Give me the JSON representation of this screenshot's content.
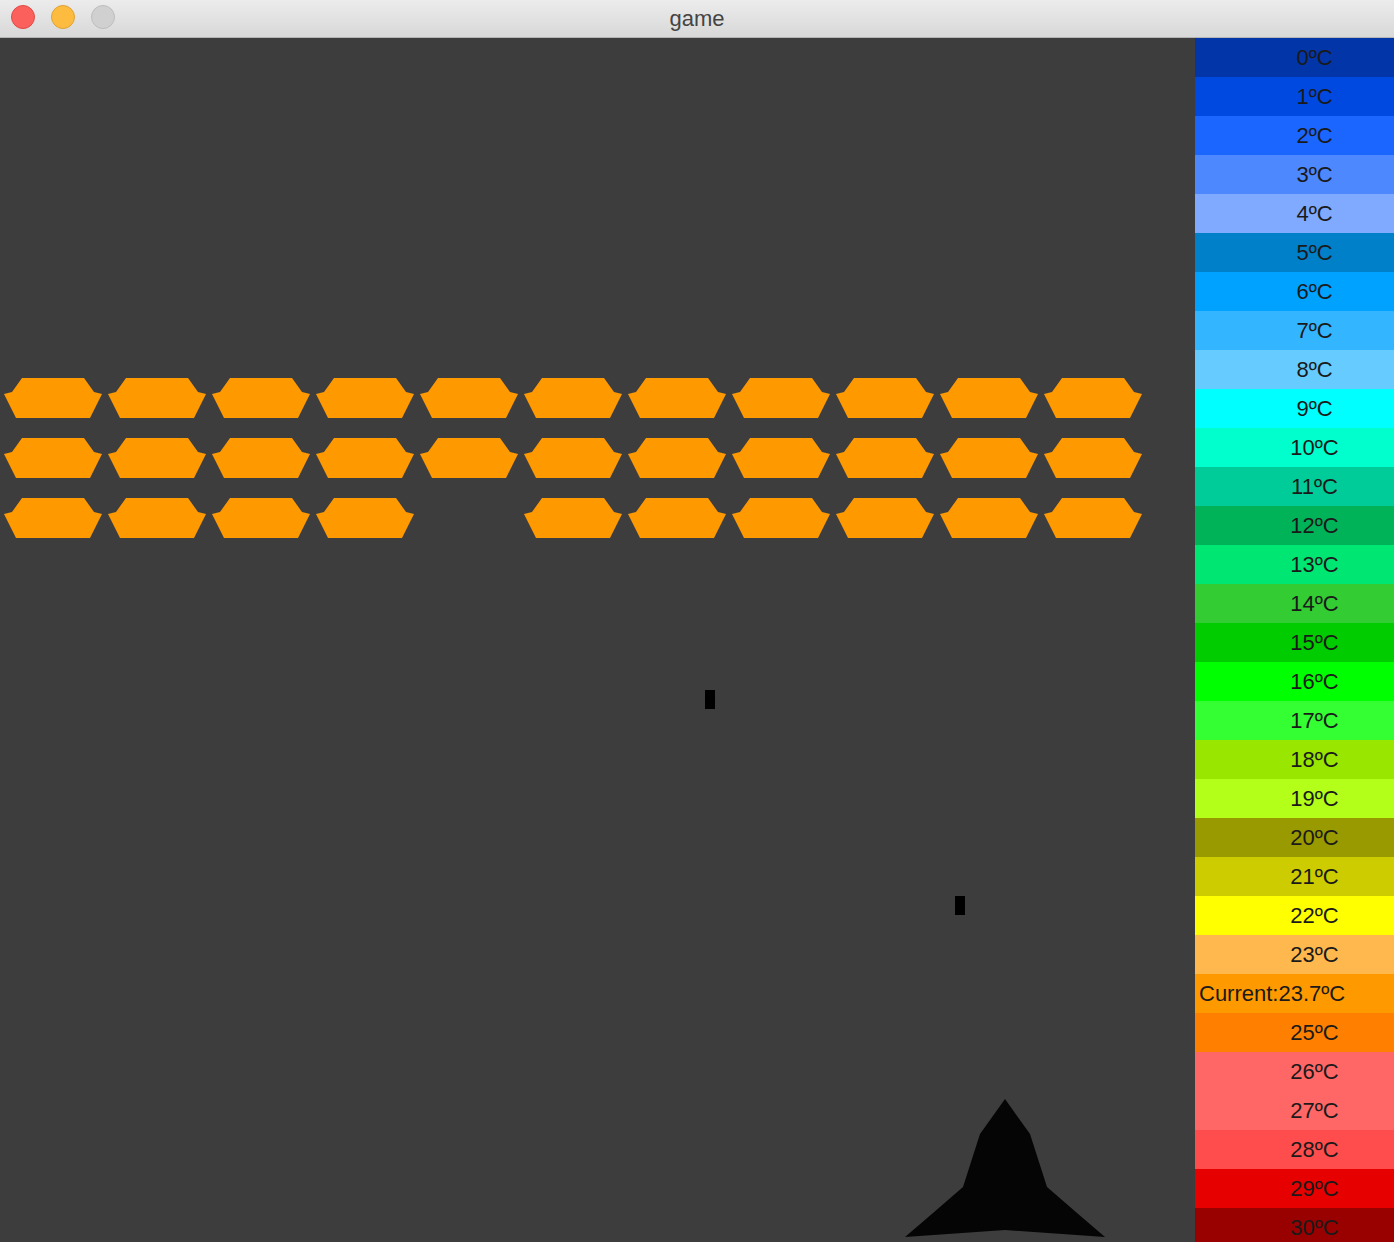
{
  "window": {
    "title": "game"
  },
  "enemies": [
    [
      {
        "alive": true
      },
      {
        "alive": true
      },
      {
        "alive": true
      },
      {
        "alive": true
      },
      {
        "alive": true
      },
      {
        "alive": true
      },
      {
        "alive": true
      },
      {
        "alive": true
      },
      {
        "alive": true
      },
      {
        "alive": true
      },
      {
        "alive": true
      }
    ],
    [
      {
        "alive": true
      },
      {
        "alive": true
      },
      {
        "alive": true
      },
      {
        "alive": true
      },
      {
        "alive": true
      },
      {
        "alive": true
      },
      {
        "alive": true
      },
      {
        "alive": true
      },
      {
        "alive": true
      },
      {
        "alive": true
      },
      {
        "alive": true
      }
    ],
    [
      {
        "alive": true
      },
      {
        "alive": true
      },
      {
        "alive": true
      },
      {
        "alive": true
      },
      {
        "alive": false
      },
      {
        "alive": true
      },
      {
        "alive": true
      },
      {
        "alive": true
      },
      {
        "alive": true
      },
      {
        "alive": true
      },
      {
        "alive": true
      }
    ]
  ],
  "temperature_scale": [
    {
      "label": "0ºC",
      "color": "#0235a8",
      "current": false
    },
    {
      "label": "1ºC",
      "color": "#0049e0",
      "current": false
    },
    {
      "label": "2ºC",
      "color": "#1a66ff",
      "current": false
    },
    {
      "label": "3ºC",
      "color": "#4d88ff",
      "current": false
    },
    {
      "label": "4ºC",
      "color": "#80aaff",
      "current": false
    },
    {
      "label": "5ºC",
      "color": "#0080c8",
      "current": false
    },
    {
      "label": "6ºC",
      "color": "#00a2ff",
      "current": false
    },
    {
      "label": "7ºC",
      "color": "#33b5ff",
      "current": false
    },
    {
      "label": "8ºC",
      "color": "#66ccff",
      "current": false
    },
    {
      "label": "9ºC",
      "color": "#00ffff",
      "current": false
    },
    {
      "label": "10ºC",
      "color": "#00ffcc",
      "current": false
    },
    {
      "label": "11ºC",
      "color": "#00cc99",
      "current": false
    },
    {
      "label": "12ºC",
      "color": "#00b359",
      "current": false
    },
    {
      "label": "13ºC",
      "color": "#00e673",
      "current": false
    },
    {
      "label": "14ºC",
      "color": "#33cc33",
      "current": false
    },
    {
      "label": "15ºC",
      "color": "#00cc00",
      "current": false
    },
    {
      "label": "16ºC",
      "color": "#00ff00",
      "current": false
    },
    {
      "label": "17ºC",
      "color": "#33ff33",
      "current": false
    },
    {
      "label": "18ºC",
      "color": "#99e600",
      "current": false
    },
    {
      "label": "19ºC",
      "color": "#b3ff1a",
      "current": false
    },
    {
      "label": "20ºC",
      "color": "#999900",
      "current": false
    },
    {
      "label": "21ºC",
      "color": "#cccc00",
      "current": false
    },
    {
      "label": "22ºC",
      "color": "#ffff00",
      "current": false
    },
    {
      "label": "23ºC",
      "color": "#ffb84d",
      "current": false
    },
    {
      "label": "Current:23.7ºC",
      "color": "#ff9900",
      "current": true
    },
    {
      "label": "25ºC",
      "color": "#ff8000",
      "current": false
    },
    {
      "label": "26ºC",
      "color": "#ff6666",
      "current": false
    },
    {
      "label": "27ºC",
      "color": "#ff6666",
      "current": false
    },
    {
      "label": "28ºC",
      "color": "#ff4d4d",
      "current": false
    },
    {
      "label": "29ºC",
      "color": "#e60000",
      "current": false
    },
    {
      "label": "30ºC",
      "color": "#990000",
      "current": false
    }
  ]
}
